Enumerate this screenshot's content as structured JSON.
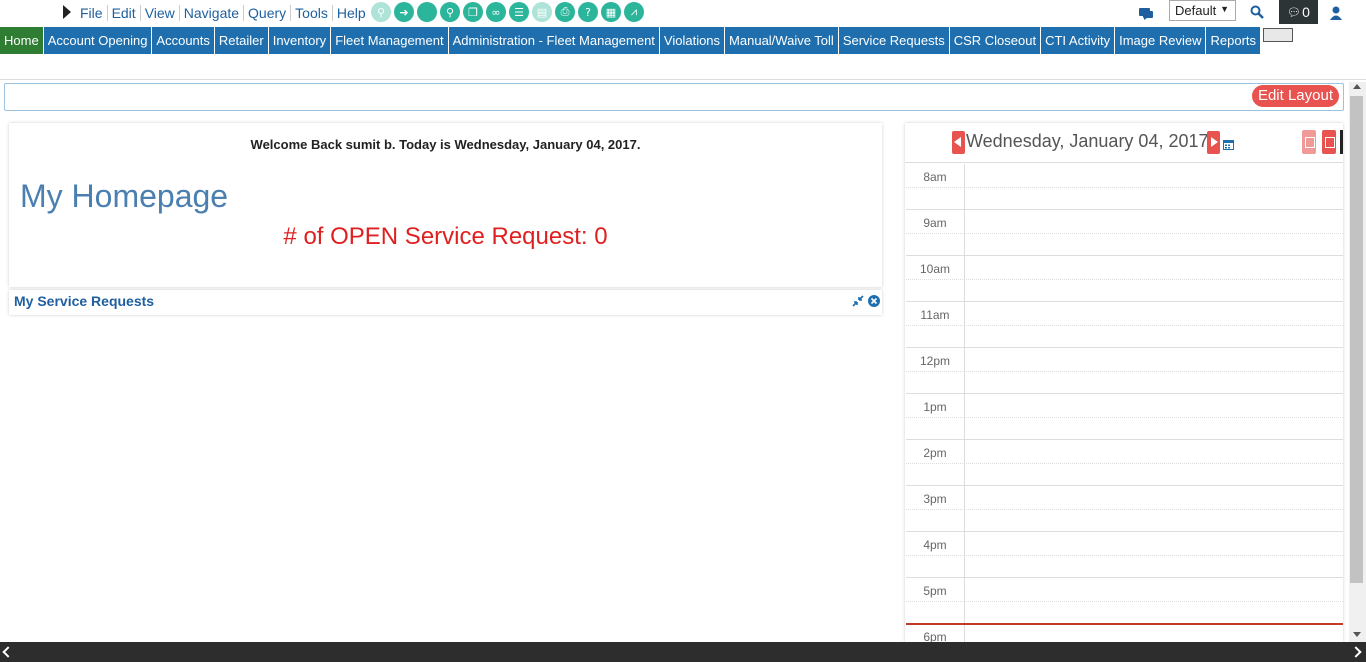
{
  "menu": [
    "File",
    "Edit",
    "View",
    "Navigate",
    "Query",
    "Tools",
    "Help"
  ],
  "toolbar_icons": [
    "search-icon",
    "go-icon",
    "circle-icon",
    "find-icon",
    "copy-icon",
    "link-icon",
    "list-icon",
    "notes-icon",
    "print-icon",
    "help-icon",
    "table-icon",
    "chart-icon"
  ],
  "profile_select": {
    "value": "Default"
  },
  "notifications": {
    "count": "0"
  },
  "nav": [
    "Home",
    "Account Opening",
    "Accounts",
    "Retailer",
    "Inventory",
    "Fleet Management",
    "Administration - Fleet Management",
    "Violations",
    "Manual/Waive Toll",
    "Service Requests",
    "CSR Closeout",
    "CTI Activity",
    "Image Review",
    "Reports"
  ],
  "layout": {
    "edit_label": "Edit Layout"
  },
  "home": {
    "welcome": "Welcome Back sumit b.  Today is Wednesday, January 04, 2017.",
    "title": "My Homepage",
    "open_sr": "# of OPEN Service Request: 0"
  },
  "service_requests": {
    "title": "My Service Requests"
  },
  "calendar": {
    "date": "Wednesday, January 04, 2017",
    "hours": [
      "8am",
      "9am",
      "10am",
      "11am",
      "12pm",
      "1pm",
      "2pm",
      "3pm",
      "4pm",
      "5pm",
      "6pm"
    ]
  },
  "colors": {
    "nav": "#1f6fae",
    "nav_active": "#2e7d32",
    "accent": "#e8534f",
    "toolbar": "#2bb59a"
  }
}
